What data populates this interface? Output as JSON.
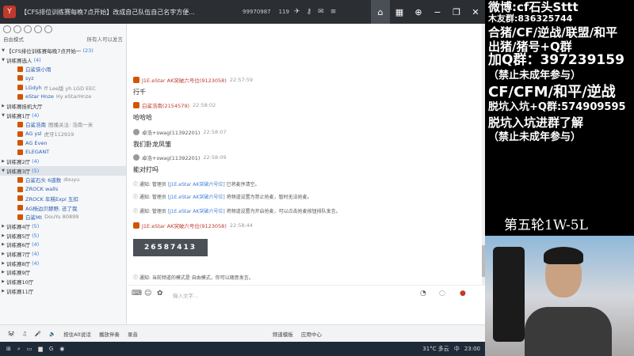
{
  "titlebar": {
    "title": "【CFS排位训练赛每晚7点开始】改成自己队伍自己名字方便...",
    "room_id": "99970987",
    "online": "119",
    "nav": [
      "home-icon",
      "grid-icon",
      "gamepad-icon",
      "minimize-icon",
      "restore-icon",
      "close-icon"
    ]
  },
  "sidebar": {
    "mode_label": "自由模式",
    "permission": "所有人可以发言",
    "channels": [
      {
        "kind": "channel",
        "label": "【CFS排位训练赛每晚7点开始一",
        "count": "(23)",
        "expanded": true
      },
      {
        "kind": "channel",
        "label": "训练赛选人",
        "count": "(4)",
        "expanded": true
      },
      {
        "kind": "user",
        "label": "白鲨侠小雨",
        "extra": ""
      },
      {
        "kind": "user",
        "label": "syz",
        "extra": ""
      },
      {
        "kind": "user",
        "label": "LGdyh",
        "extra": "ff Lee版 yh LGD EEC"
      },
      {
        "kind": "user",
        "label": "eStar Hnze",
        "extra": "Hy eStarHnze"
      },
      {
        "kind": "channel",
        "label": "训练赛挂机大厅",
        "count": "",
        "expanded": false
      },
      {
        "kind": "channel",
        "label": "训练赛1厅",
        "count": "(4)",
        "expanded": true
      },
      {
        "kind": "user",
        "label": "白鲨浩南",
        "extra": "图播关注: 浩南一米"
      },
      {
        "kind": "user",
        "label": "AG ysl",
        "extra": "虎牙112919"
      },
      {
        "kind": "user",
        "label": "AG Even",
        "extra": ""
      },
      {
        "kind": "user",
        "label": "ELEGANT",
        "extra": ""
      },
      {
        "kind": "channel",
        "label": "训练赛2厅",
        "count": "(4)",
        "expanded": false
      },
      {
        "kind": "channel",
        "label": "训练赛3厅",
        "count": "(5)",
        "expanded": true,
        "active": true
      },
      {
        "kind": "user",
        "label": "白鲨石头 6道数",
        "extra": "douyu"
      },
      {
        "kind": "user",
        "label": "ZROCK walls",
        "extra": ""
      },
      {
        "kind": "user",
        "label": "ZROCK 年糕Expi 五扣",
        "extra": ""
      },
      {
        "kind": "user",
        "label": "AG杨边贝赫野, 还了我",
        "extra": ""
      },
      {
        "kind": "user",
        "label": "白鲨Mt",
        "extra": "DouYu 80899"
      },
      {
        "kind": "channel",
        "label": "训练赛4厅",
        "count": "(5)",
        "expanded": false
      },
      {
        "kind": "channel",
        "label": "训练赛5厅",
        "count": "(5)",
        "expanded": false
      },
      {
        "kind": "channel",
        "label": "训练赛6厅",
        "count": "(4)",
        "expanded": false
      },
      {
        "kind": "channel",
        "label": "训练赛7厅",
        "count": "(4)",
        "expanded": false
      },
      {
        "kind": "channel",
        "label": "训练赛8厅",
        "count": "(4)",
        "expanded": false
      },
      {
        "kind": "channel",
        "label": "训练赛9厅",
        "count": "",
        "expanded": false
      },
      {
        "kind": "channel",
        "label": "训练赛10厅",
        "count": "",
        "expanded": false
      },
      {
        "kind": "channel",
        "label": "训练赛11厅",
        "count": "",
        "expanded": false
      }
    ]
  },
  "chat": {
    "messages": [
      {
        "name": "J1E.eStar AK突破六号位(9123058)",
        "time": "22:57:59",
        "text": "行千",
        "style": "red"
      },
      {
        "name": "白鲨浩南(2154579)",
        "time": "22:58:02",
        "text": "哈哈哈",
        "style": "red"
      },
      {
        "name": "卓浩+swag(11392201)",
        "time": "22:58:07",
        "text": "我们卧龙凤雏",
        "style": "gray"
      },
      {
        "name": "卓浩+swag(11392201)",
        "time": "22:58:09",
        "text": "能对打吗",
        "style": "gray"
      }
    ],
    "notices": [
      {
        "prefix": "通知: 管理员",
        "who": "[J1E.eStar AK突破六号位]",
        "suffix": "已将麦序清空。"
      },
      {
        "prefix": "通知: 管理员",
        "who": "[J1E.eStar AK突破六号位]",
        "suffix": "将频道设置为禁止抢麦，暂时无法抢麦。"
      },
      {
        "prefix": "通知: 管理员",
        "who": "[J1E.eStar AK突破六号位]",
        "suffix": "将频道设置为开启抢麦，可以点击抢麦按钮排队发言。"
      }
    ],
    "last_msg": {
      "name": "J1E.eStar AK突破六号位(9123058)",
      "time": "22:58:44"
    },
    "code": "26587413",
    "final_notice": "通知: 当前频道的模式是 自由模式，你可以随意发言。",
    "input_placeholder": "输入文字..."
  },
  "bottombar": {
    "items": [
      "按住Alt说话",
      "播放伴奏",
      "录音",
      "频道模板",
      "应用中心"
    ]
  },
  "taskbar": {
    "weather": "31°C 多云",
    "ime": "中",
    "time": "23:00"
  },
  "overlay": {
    "lines": [
      "微博:cf石头Sttt",
      "木友群:836325744",
      "合猪/CF/逆战/联盟/和平",
      "出猪/猪号+Q群",
      "加Q群：397239159",
      "（禁止未成年参与）",
      "CF/CFM/和平/逆战",
      "脱坑入坑+Q群:574909595",
      "脱坑入坑进群了解",
      "（禁止未成年参与）"
    ],
    "round": "第五轮1W-5L"
  }
}
